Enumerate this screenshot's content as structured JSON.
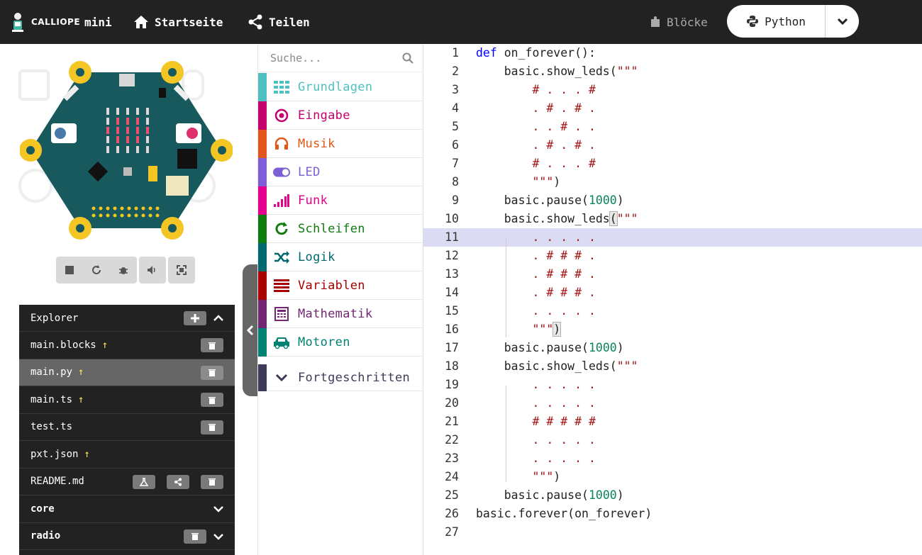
{
  "header": {
    "logo_brand": "CALLIOPE",
    "logo_product": "mini",
    "home_label": "Startseite",
    "share_label": "Teilen",
    "blocks_label": "Blöcke",
    "python_label": "Python"
  },
  "toolbox": {
    "search_placeholder": "Suche...",
    "categories": [
      {
        "label": "Grundlagen",
        "color": "#4fbfbf",
        "icon": "grid-icon"
      },
      {
        "label": "Eingabe",
        "color": "#c3006b",
        "icon": "target-icon"
      },
      {
        "label": "Musik",
        "color": "#e0561b",
        "icon": "headphones-icon"
      },
      {
        "label": "LED",
        "color": "#7f5fd6",
        "icon": "toggle-icon"
      },
      {
        "label": "Funk",
        "color": "#e3008c",
        "icon": "signal-bars-icon"
      },
      {
        "label": "Schleifen",
        "color": "#107c10",
        "icon": "refresh-icon"
      },
      {
        "label": "Logik",
        "color": "#006970",
        "icon": "shuffle-icon"
      },
      {
        "label": "Variablen",
        "color": "#a80000",
        "icon": "list-icon"
      },
      {
        "label": "Mathematik",
        "color": "#712672",
        "icon": "calculator-icon"
      },
      {
        "label": "Motoren",
        "color": "#008272",
        "icon": "car-icon"
      }
    ],
    "advanced_label": "Fortgeschritten",
    "advanced_color": "#3c3c5a"
  },
  "explorer": {
    "title": "Explorer",
    "files": [
      {
        "name": "main.blocks",
        "arrow": "↑"
      },
      {
        "name": "main.py",
        "arrow": "↑"
      },
      {
        "name": "main.ts",
        "arrow": "↑"
      },
      {
        "name": "test.ts",
        "arrow": ""
      },
      {
        "name": "pxt.json",
        "arrow": "↑"
      },
      {
        "name": "README.md",
        "arrow": ""
      }
    ],
    "sections": [
      "core",
      "radio"
    ]
  },
  "editor": {
    "lines": [
      {
        "n": "1",
        "html": "<span class=\"kw\">def</span> on_forever():"
      },
      {
        "n": "2",
        "html": "    basic.show_leds(<span class=\"str\">\"\"\"</span>"
      },
      {
        "n": "3",
        "html": "<span class=\"str\">        # . . . #</span>"
      },
      {
        "n": "4",
        "html": "<span class=\"str\">        . # . # .</span>"
      },
      {
        "n": "5",
        "html": "<span class=\"str\">        . . # . .</span>"
      },
      {
        "n": "6",
        "html": "<span class=\"str\">        . # . # .</span>"
      },
      {
        "n": "7",
        "html": "<span class=\"str\">        # . . . #</span>"
      },
      {
        "n": "8",
        "html": "<span class=\"str\">        \"\"\"</span>)"
      },
      {
        "n": "9",
        "html": "    basic.pause(<span class=\"num\">1000</span>)"
      },
      {
        "n": "10",
        "html": "    basic.show_leds<span class=\"bracket\">(</span><span class=\"str\">\"\"\"</span>"
      },
      {
        "n": "11",
        "html": "<span class=\"str\">        . . . . .</span>"
      },
      {
        "n": "12",
        "html": "<span class=\"str\">        . # # # .</span>"
      },
      {
        "n": "13",
        "html": "<span class=\"str\">        . # # # .</span>"
      },
      {
        "n": "14",
        "html": "<span class=\"str\">        . # # # .</span>"
      },
      {
        "n": "15",
        "html": "<span class=\"str\">        . . . . .</span>"
      },
      {
        "n": "16",
        "html": "<span class=\"str\">        \"\"\"</span><span class=\"bracket\">)</span>"
      },
      {
        "n": "17",
        "html": "    basic.pause(<span class=\"num\">1000</span>)"
      },
      {
        "n": "18",
        "html": "    basic.show_leds(<span class=\"str\">\"\"\"</span>"
      },
      {
        "n": "19",
        "html": "<span class=\"str\">        . . . . .</span>"
      },
      {
        "n": "20",
        "html": "<span class=\"str\">        . . . . .</span>"
      },
      {
        "n": "21",
        "html": "<span class=\"str\">        # # # # #</span>"
      },
      {
        "n": "22",
        "html": "<span class=\"str\">        . . . . .</span>"
      },
      {
        "n": "23",
        "html": "<span class=\"str\">        . . . . .</span>"
      },
      {
        "n": "24",
        "html": "<span class=\"str\">        \"\"\"</span>)"
      },
      {
        "n": "25",
        "html": "    basic.pause(<span class=\"num\">1000</span>)"
      },
      {
        "n": "26",
        "html": "basic.forever(on_forever)"
      },
      {
        "n": "27",
        "html": ""
      }
    ],
    "active_line": 11
  }
}
